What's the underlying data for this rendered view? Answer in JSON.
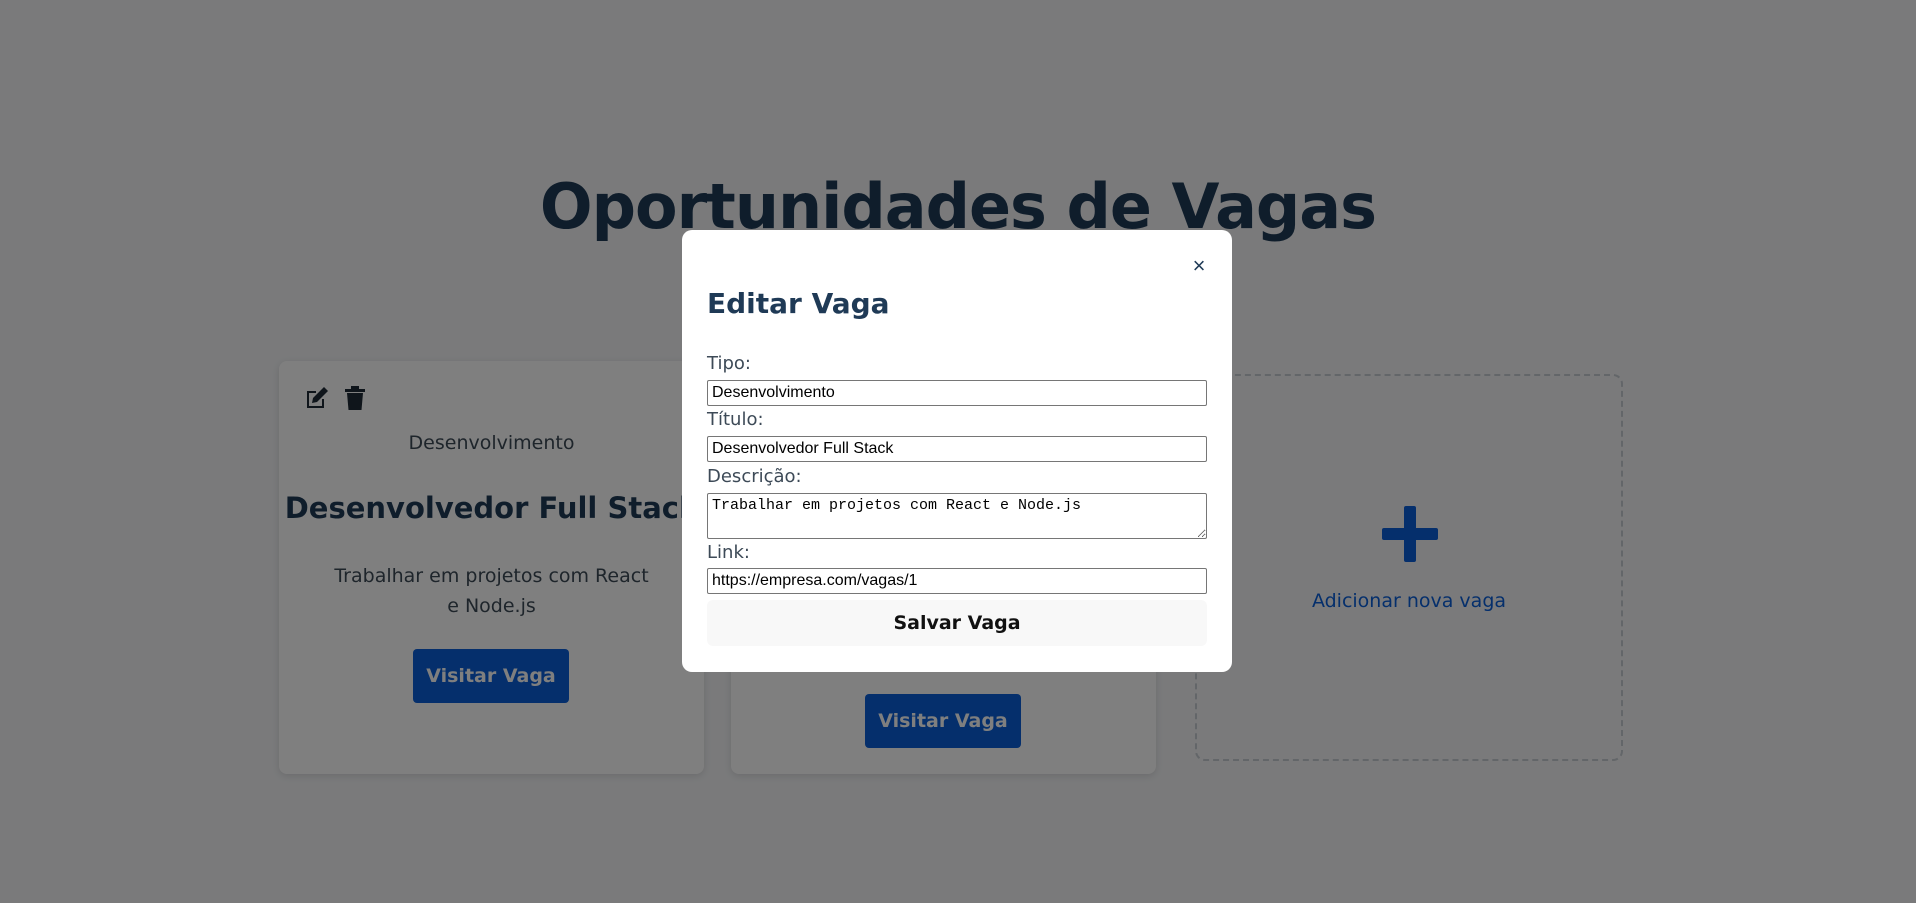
{
  "page": {
    "title": "Oportunidades de Vagas"
  },
  "cards": [
    {
      "type": "Desenvolvimento",
      "title": "Desenvolvedor Full Stack",
      "description": "Trabalhar em projetos com React e Node.js",
      "visit_label": "Visitar Vaga"
    },
    {
      "visit_label": "Visitar Vaga"
    }
  ],
  "add_card": {
    "label": "Adicionar nova vaga",
    "icon": "plus-icon"
  },
  "modal": {
    "close_symbol": "×",
    "title": "Editar Vaga",
    "fields": {
      "tipo": {
        "label": "Tipo:",
        "value": "Desenvolvimento"
      },
      "titulo": {
        "label": "Título:",
        "value": "Desenvolvedor Full Stack"
      },
      "descricao": {
        "label": "Descrição:",
        "value": "Trabalhar em projetos com React e Node.js"
      },
      "link": {
        "label": "Link:",
        "value": "https://empresa.com/vagas/1"
      }
    },
    "save_label": "Salvar Vaga"
  },
  "colors": {
    "accent": "#0a5fd8",
    "heading": "#1f3a56",
    "overlay": "rgba(0,0,0,0.5)"
  }
}
